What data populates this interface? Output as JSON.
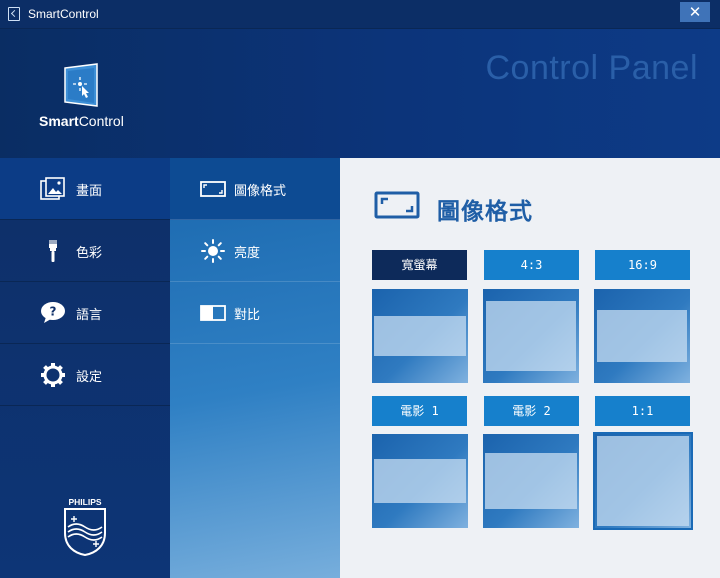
{
  "window": {
    "title": "SmartControl",
    "close_label": "✕"
  },
  "header": {
    "title": "Control Panel",
    "logo_text_bold": "Smart",
    "logo_text_regular": "Control"
  },
  "sidebar": {
    "items": [
      {
        "label": "畫面",
        "icon": "picture-icon"
      },
      {
        "label": "色彩",
        "icon": "brush-icon"
      },
      {
        "label": "語言",
        "icon": "speech-bubble-icon"
      },
      {
        "label": "設定",
        "icon": "gear-icon"
      }
    ],
    "brand": "PHILIPS"
  },
  "submenu": {
    "items": [
      {
        "label": "圖像格式",
        "icon": "aspect-ratio-icon"
      },
      {
        "label": "亮度",
        "icon": "sun-icon"
      },
      {
        "label": "對比",
        "icon": "contrast-icon"
      }
    ]
  },
  "main": {
    "title": "圖像格式",
    "formats": [
      {
        "label": "寬螢幕"
      },
      {
        "label": "4:3"
      },
      {
        "label": "16:9"
      },
      {
        "label": "電影 1"
      },
      {
        "label": "電影 2"
      },
      {
        "label": "1:1"
      }
    ]
  },
  "colors": {
    "accent": "#1680cc",
    "selected": "#0d2a5a",
    "title": "#1f5ea6"
  }
}
